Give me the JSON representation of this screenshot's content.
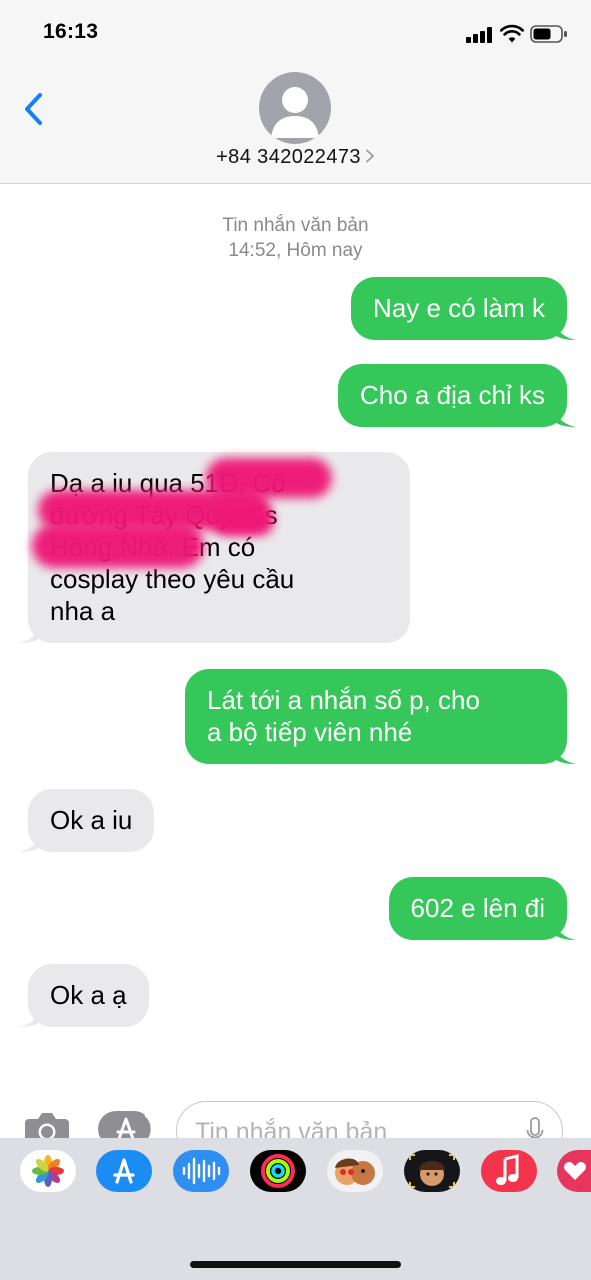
{
  "status_bar": {
    "time": "16:13"
  },
  "header": {
    "contact": "+84 342022473"
  },
  "conversation": {
    "service_label": "Tin nhắn văn bản",
    "timestamp": "14:52, Hôm nay",
    "messages": [
      {
        "direction": "outgoing",
        "text": "Nay e có làm k"
      },
      {
        "direction": "outgoing",
        "text": "Cho a địa chỉ ks"
      },
      {
        "direction": "incoming",
        "lines": [
          "Dạ a iu qua 51D, Cô",
          "đường Tây Quý. Ks",
          "Hồng Nhã. Em có",
          "cosplay theo yêu cầu",
          "nha a"
        ],
        "partially_redacted": true
      },
      {
        "direction": "outgoing",
        "lines": [
          "Lát tới a nhắn số p, cho",
          "a bộ tiếp viên nhé"
        ]
      },
      {
        "direction": "incoming",
        "text": "Ok a iu"
      },
      {
        "direction": "outgoing",
        "text": "602 e lên đi"
      },
      {
        "direction": "incoming",
        "text": "Ok a ạ"
      }
    ]
  },
  "composer": {
    "placeholder": "Tin nhắn văn bản",
    "value": ""
  },
  "app_drawer": {
    "apps": [
      "photos-icon",
      "app-store-icon",
      "audio-message-icon",
      "activity-icon",
      "memoji-stickers-icon",
      "animoji-icon",
      "music-icon",
      "digital-touch-icon"
    ]
  },
  "colors": {
    "outgoing_bubble": "#35c759",
    "incoming_bubble": "#e9e9eb",
    "accent": "#147efb",
    "redaction": "#ee1877"
  }
}
